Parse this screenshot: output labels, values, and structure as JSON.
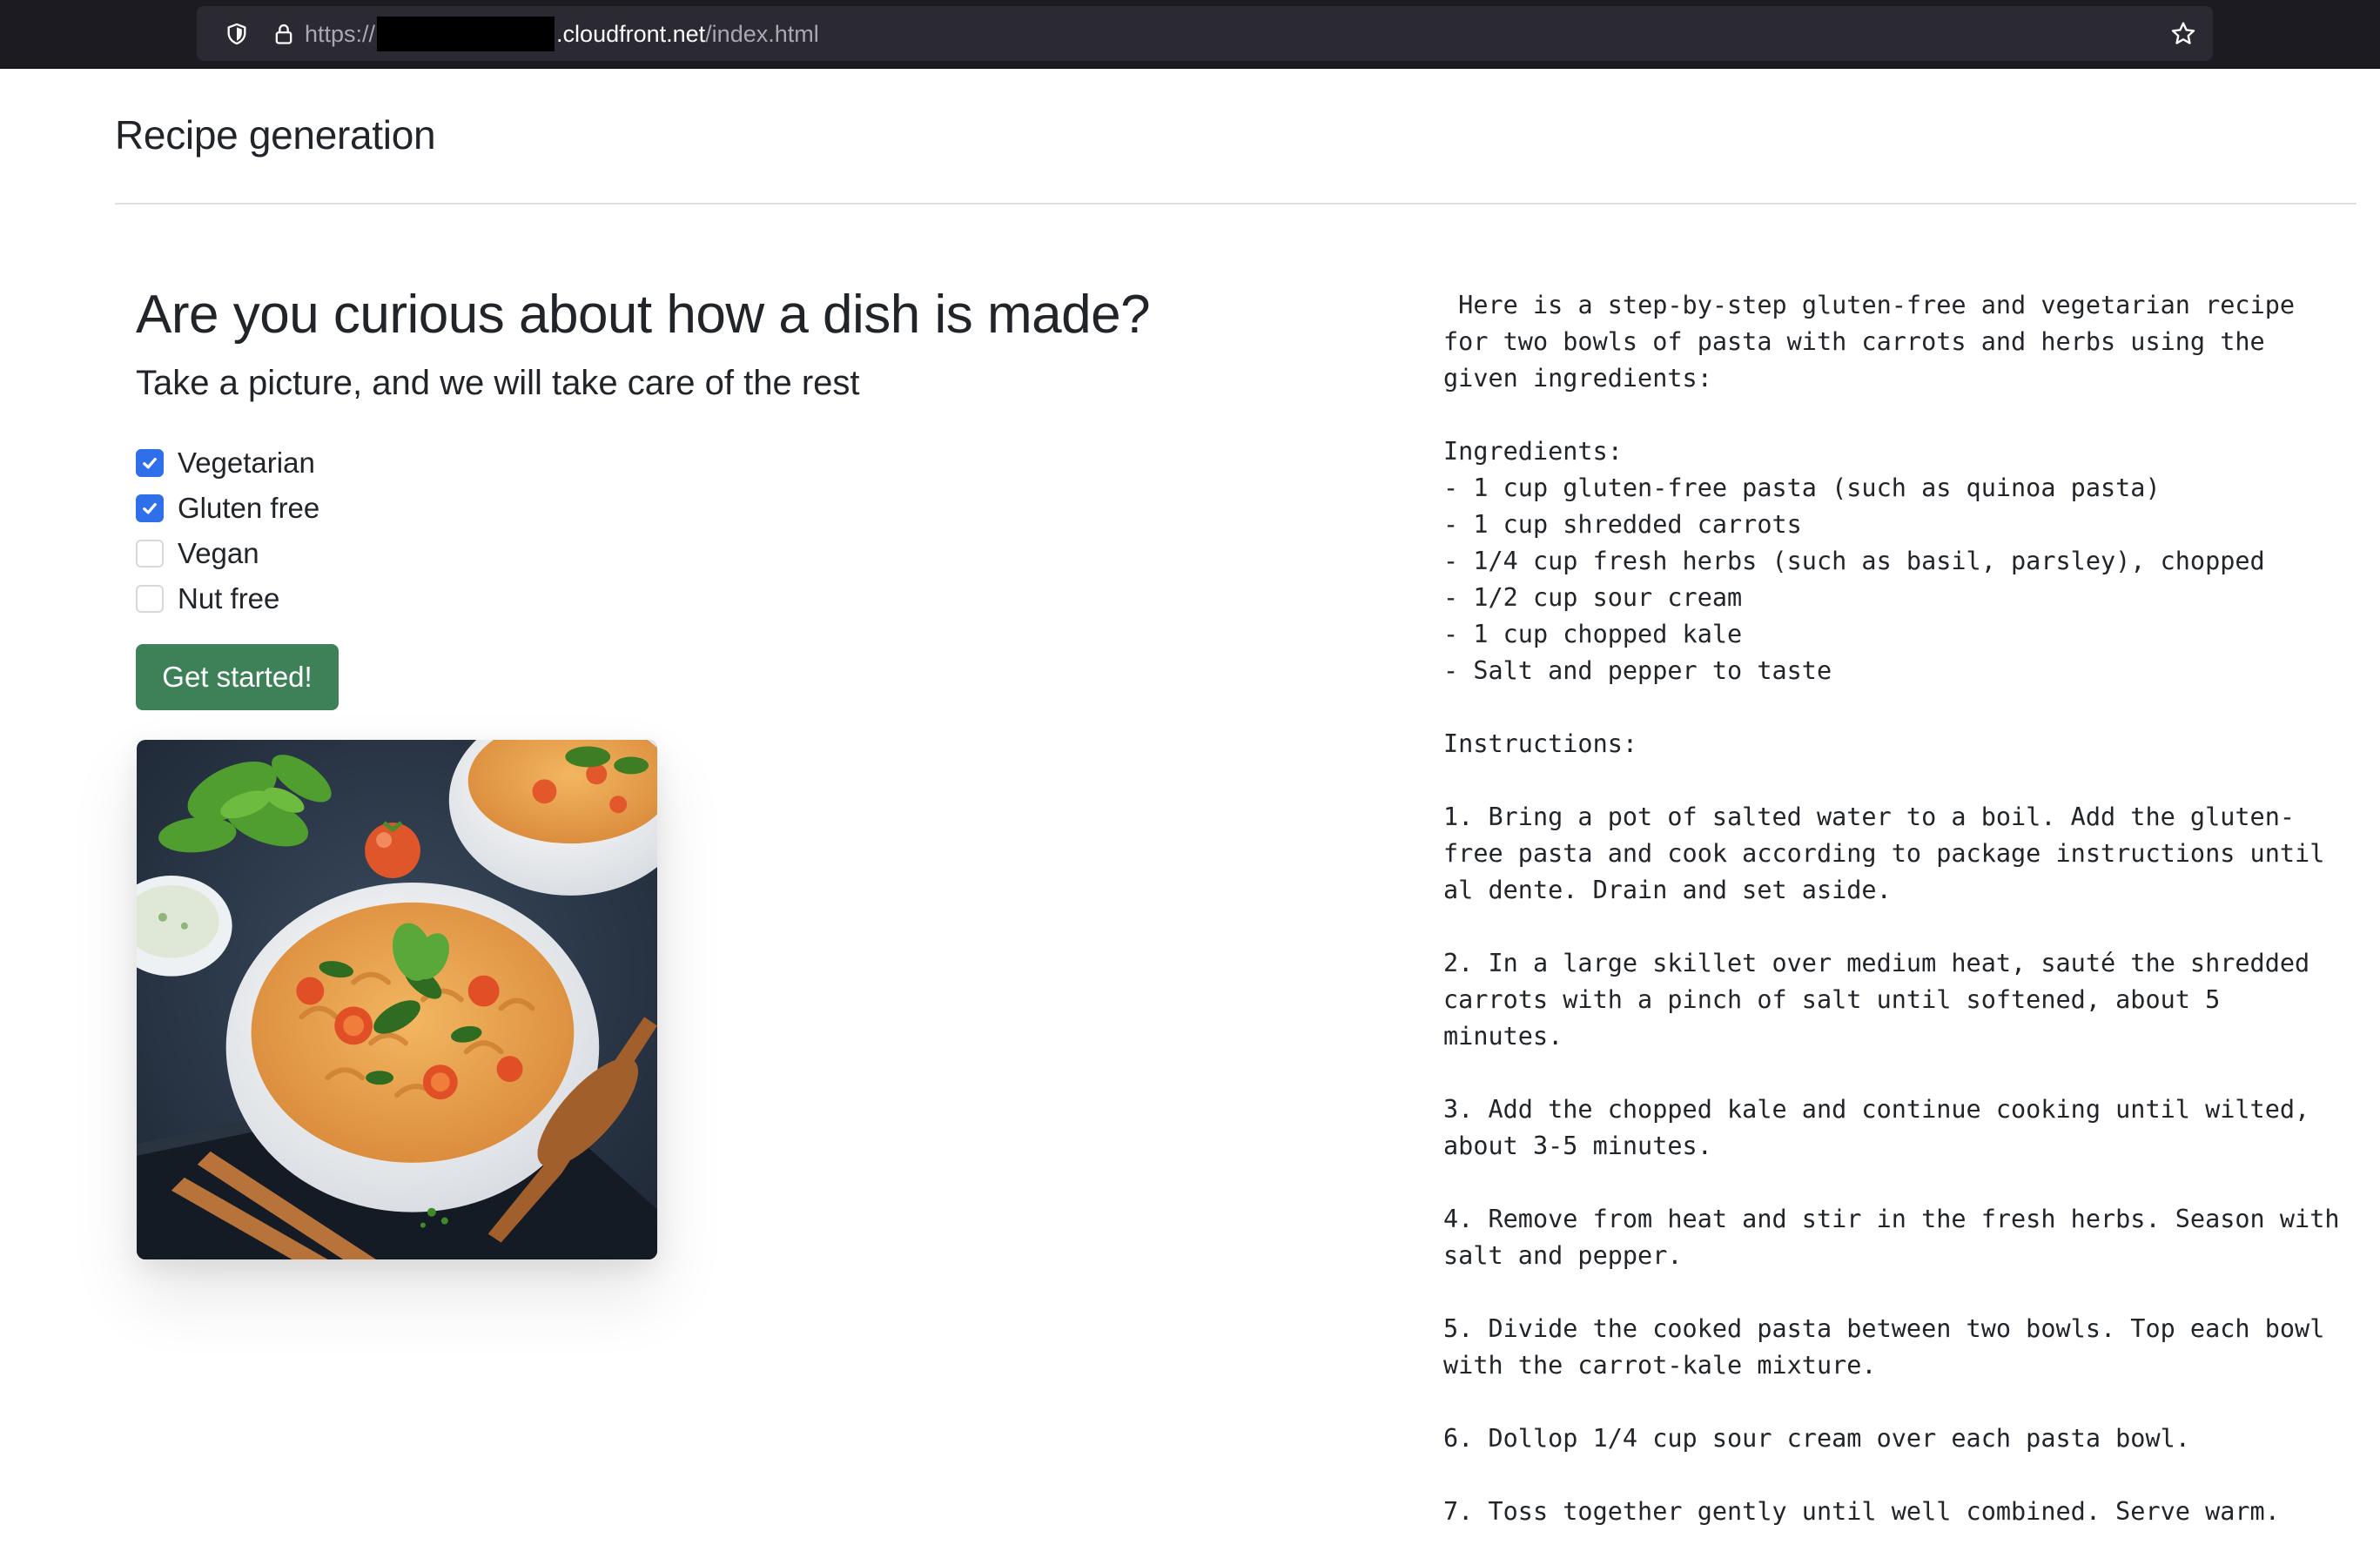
{
  "browser": {
    "url_scheme": "https://",
    "url_host": ".cloudfront.net",
    "url_path": "/index.html",
    "icons": [
      "shield-icon",
      "lock-icon",
      "star-icon"
    ]
  },
  "page": {
    "header_title": "Recipe generation",
    "hero_title": "Are you curious about how a dish is made?",
    "hero_lead": "Take a picture, and we will take care of the rest"
  },
  "options": [
    {
      "label": "Vegetarian",
      "checked": true
    },
    {
      "label": "Gluten free",
      "checked": true
    },
    {
      "label": "Vegan",
      "checked": false
    },
    {
      "label": "Nut free",
      "checked": false
    }
  ],
  "actions": {
    "start_label": "Get started!"
  },
  "recipe": {
    "text": " Here is a step-by-step gluten-free and vegetarian recipe\nfor two bowls of pasta with carrots and herbs using the\ngiven ingredients:\n\nIngredients:\n- 1 cup gluten-free pasta (such as quinoa pasta)\n- 1 cup shredded carrots\n- 1/4 cup fresh herbs (such as basil, parsley), chopped\n- 1/2 cup sour cream\n- 1 cup chopped kale\n- Salt and pepper to taste\n\nInstructions:\n\n1. Bring a pot of salted water to a boil. Add the gluten-\nfree pasta and cook according to package instructions until\nal dente. Drain and set aside.\n\n2. In a large skillet over medium heat, sauté the shredded\ncarrots with a pinch of salt until softened, about 5\nminutes.\n\n3. Add the chopped kale and continue cooking until wilted,\nabout 3-5 minutes.\n\n4. Remove from heat and stir in the fresh herbs. Season with\nsalt and pepper.\n\n5. Divide the cooked pasta between two bowls. Top each bowl\nwith the carrot-kale mixture.\n\n6. Dollop 1/4 cup sour cream over each pasta bowl.\n\n7. Toss together gently until well combined. Serve warm."
  },
  "colors": {
    "browser_bg": "#1c1b22",
    "url_bar_bg": "#2b2a33",
    "checkbox_checked": "#2f6fea",
    "button_bg": "#3e8158",
    "text": "#212529"
  }
}
